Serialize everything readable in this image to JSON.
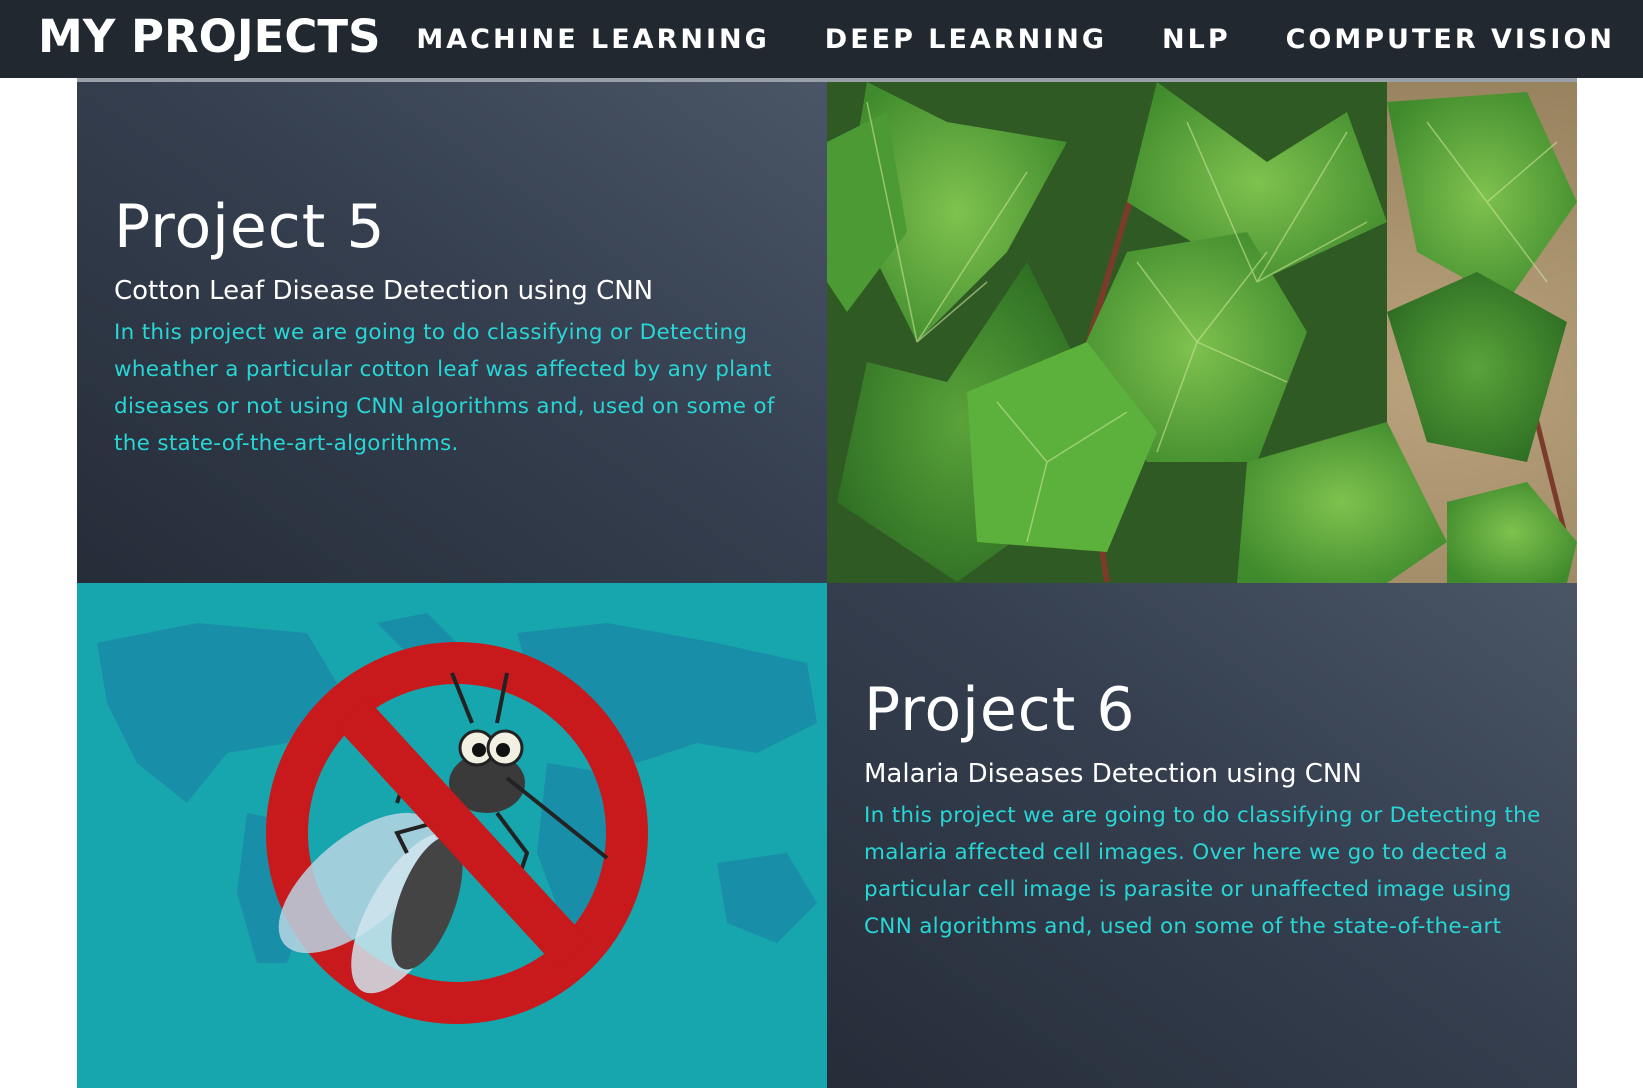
{
  "navbar": {
    "brand": "MY PROJECTS",
    "links": [
      "MACHINE LEARNING",
      "DEEP LEARNING",
      "NLP",
      "COMPUTER VISION"
    ]
  },
  "projects": [
    {
      "title": "Project 5",
      "subtitle": "Cotton Leaf Disease Detection using CNN",
      "description": "In this project we are going to do classifying or Detecting wheather a particular cotton leaf was affected by any plant diseases or not using CNN algorithms and, used on some of the state-of-the-art-algorithms."
    },
    {
      "title": "Project 6",
      "subtitle": "Malaria Diseases Detection using CNN",
      "description": "In this project we are going to do classifying or Detecting the malaria affected cell images. Over here we go to dected a particular cell image is parasite or unaffected image using CNN algorithms and, used on some of the state-of-the-art"
    }
  ],
  "colors": {
    "navbar_bg": "#212830",
    "description_text": "#28d6d6",
    "malaria_bg": "#17a6ad",
    "ban_sign": "#c8191c"
  }
}
